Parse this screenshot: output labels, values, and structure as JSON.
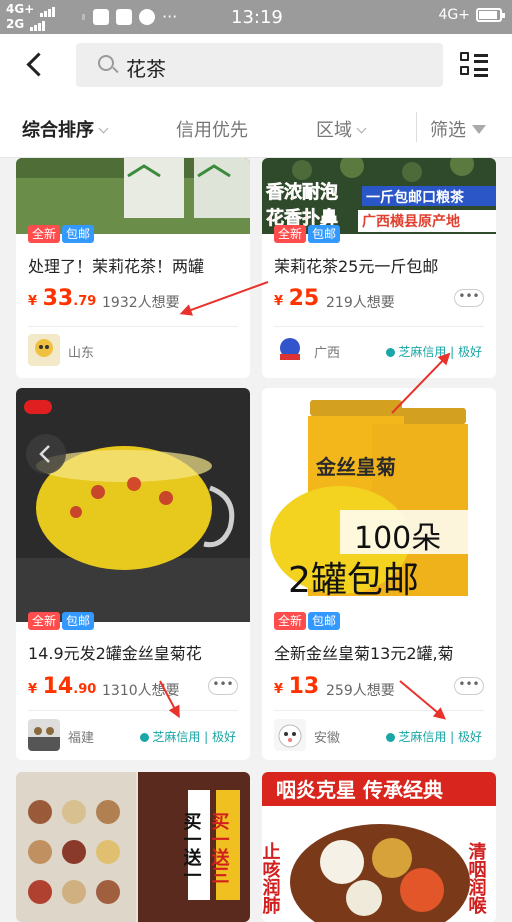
{
  "status_bar": {
    "network_top": "4G+",
    "network_bottom": "2G",
    "time": "13:19",
    "network_right": "4G+"
  },
  "search": {
    "query": "花茶"
  },
  "filters": {
    "sort": "综合排序",
    "credit": "信用优先",
    "region": "区域",
    "filter": "筛选"
  },
  "listings": [
    {
      "title": "处理了！茉莉花茶！两罐",
      "price_symbol": "¥",
      "price_int": "33",
      "price_dec": ".79",
      "wants": "1932人想要",
      "location": "山东",
      "badge_new": "全新",
      "badge_post": "包邮"
    },
    {
      "title": "茉莉花茶25元一斤包邮",
      "price_symbol": "¥",
      "price_int": "25",
      "price_dec": "",
      "wants": "219人想要",
      "location": "广西",
      "credit": "芝麻信用 | 极好",
      "badge_new": "全新",
      "badge_post": "包邮",
      "image_text_1": "香浓耐泡",
      "image_text_2": "花香扑鼻",
      "image_text_3": "一斤包邮口粮茶",
      "image_text_4": "广西横县原产地"
    },
    {
      "title": "14.9元发2罐金丝皇菊花",
      "price_symbol": "¥",
      "price_int": "14",
      "price_dec": ".90",
      "wants": "1310人想要",
      "location": "福建",
      "credit": "芝麻信用 | 极好",
      "badge_new": "全新",
      "badge_post": "包邮"
    },
    {
      "title": "全新金丝皇菊13元2罐,菊",
      "price_symbol": "¥",
      "price_int": "13",
      "price_dec": "",
      "wants": "259人想要",
      "location": "安徽",
      "credit": "芝麻信用 | 极好",
      "badge_new": "全新",
      "badge_post": "包邮",
      "image_text_1": "100朵",
      "image_text_2": "2罐包邮",
      "jar_label": "金丝皇菊"
    },
    {
      "image_text_1": "买一送一",
      "image_text_2": "买一送三"
    },
    {
      "image_text_1": "咽炎克星 传承经典",
      "image_text_2": "止咳润肺",
      "image_text_3": "清咽润喉"
    }
  ],
  "more_label": "•••",
  "colors": {
    "price": "#ff3300",
    "badge_new": "#ff4d4d",
    "badge_post": "#3399ff",
    "credit": "#1aa6a6",
    "annotation_arrow": "#e8322b"
  }
}
